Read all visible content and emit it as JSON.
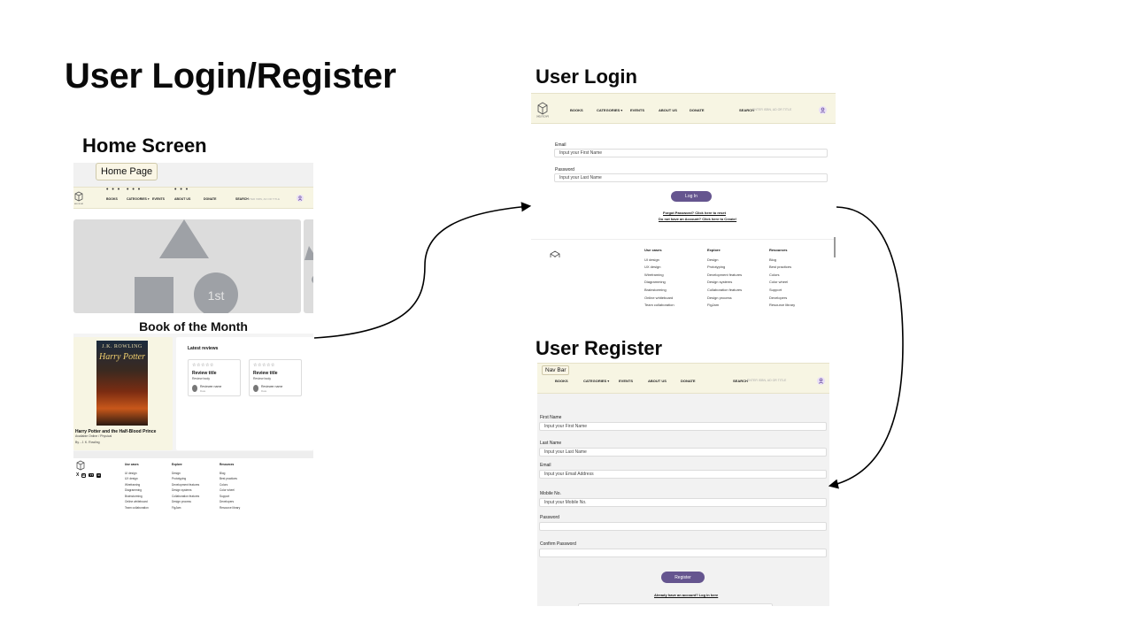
{
  "slide": {
    "title": "User Login/Register",
    "home_section": "Home Screen",
    "login_section": "User Login",
    "register_section": "User Register"
  },
  "brand": {
    "logo_text": "SHELFSCAPE"
  },
  "nav": {
    "books": "BOOKS",
    "categories": "CATEGORIES",
    "events": "EVENTS",
    "about": "ABOUT US",
    "donate": "DONATE",
    "search": "SEARCH",
    "search_placeholder": "ENTER ISBN, AD OR TITLE",
    "dots": "• • •"
  },
  "home": {
    "page_label": "Home Page",
    "hero_badge": "1st",
    "book_of_month": "Book of the Month",
    "book": {
      "cover_author": "J.K. ROWLING",
      "cover_title": "Harry Potter",
      "title": "Harry Potter and the Half-Blood Prince",
      "subtitle": "Available Online / Physical",
      "author": "By - J. K. Rowling"
    },
    "latest_reviews": "Latest reviews",
    "reviews": [
      {
        "stars": "☆☆☆☆☆",
        "title": "Review title",
        "body": "Review body",
        "name": "Reviewer name",
        "date": "Date"
      },
      {
        "stars": "☆☆☆☆☆",
        "title": "Review title",
        "body": "Review body",
        "name": "Reviewer name",
        "date": "Date"
      }
    ]
  },
  "footer": {
    "use_cases": {
      "head": "Use cases",
      "items": [
        "UI design",
        "UX design",
        "Wireframing",
        "Diagramming",
        "Brainstorming",
        "Online whiteboard",
        "Team collaboration"
      ]
    },
    "explore": {
      "head": "Explore",
      "items": [
        "Design",
        "Prototyping",
        "Development features",
        "Design systems",
        "Collaboration features",
        "Design process",
        "FigJam"
      ]
    },
    "resources": {
      "head": "Resources",
      "items": [
        "Blog",
        "Best practices",
        "Colors",
        "Color wheel",
        "Support",
        "Developers",
        "Resource library"
      ]
    },
    "socials": [
      "X",
      "IG",
      "YT",
      "in"
    ]
  },
  "login": {
    "email_label": "Email",
    "email_placeholder": "Input your First Name",
    "password_label": "Password",
    "password_placeholder": "Input your Last Name",
    "button": "Log In",
    "forgot": "Forgot Password? Click here to reset",
    "no_account": "Do not have an Account? Click here to Create!"
  },
  "register": {
    "navbar_label": "Nav Bar",
    "first_name_label": "First Name",
    "first_name_placeholder": "Input your First Name",
    "last_name_label": "Last Name",
    "last_name_placeholder": "Input your Last Name",
    "email_label": "Email",
    "email_placeholder": "Input your Email Address",
    "mobile_label": "Mobile No.",
    "mobile_placeholder": "Input your Mobile No.",
    "password_label": "Password",
    "confirm_label": "Confirm Password",
    "button": "Register",
    "have_account": "Already have an account? Log in here"
  },
  "colors": {
    "nav_bg": "#f7f5e3",
    "primary": "#65558f",
    "placeholder_gray": "#dcdcdc",
    "shape_gray": "#9ea1a6"
  }
}
